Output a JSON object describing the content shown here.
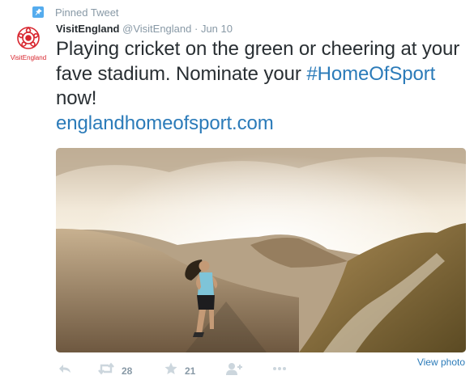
{
  "pinned": {
    "label": "Pinned Tweet"
  },
  "author": {
    "name": "VisitEngland",
    "handle": "@VisitEngland",
    "separator": "·",
    "date": "Jun 10",
    "avatar_caption": "VisitEngland"
  },
  "tweet": {
    "text_1": "Playing cricket on the green or cheering at your fave stadium. Nominate your ",
    "hashtag": "#HomeOfSport",
    "text_2": " now!",
    "link": "englandhomeofsport.com"
  },
  "media": {
    "view_photo_label": "View photo"
  },
  "actions": {
    "retweet_count": "28",
    "favorite_count": "21",
    "icons": [
      "reply-icon",
      "retweet-icon",
      "favorite-icon",
      "follow-icon",
      "more-icon"
    ]
  },
  "colors": {
    "link": "#2b7bb9",
    "muted": "#8899a6",
    "text": "#292f33",
    "pin": "#55acee",
    "brand_red": "#d8262f"
  }
}
